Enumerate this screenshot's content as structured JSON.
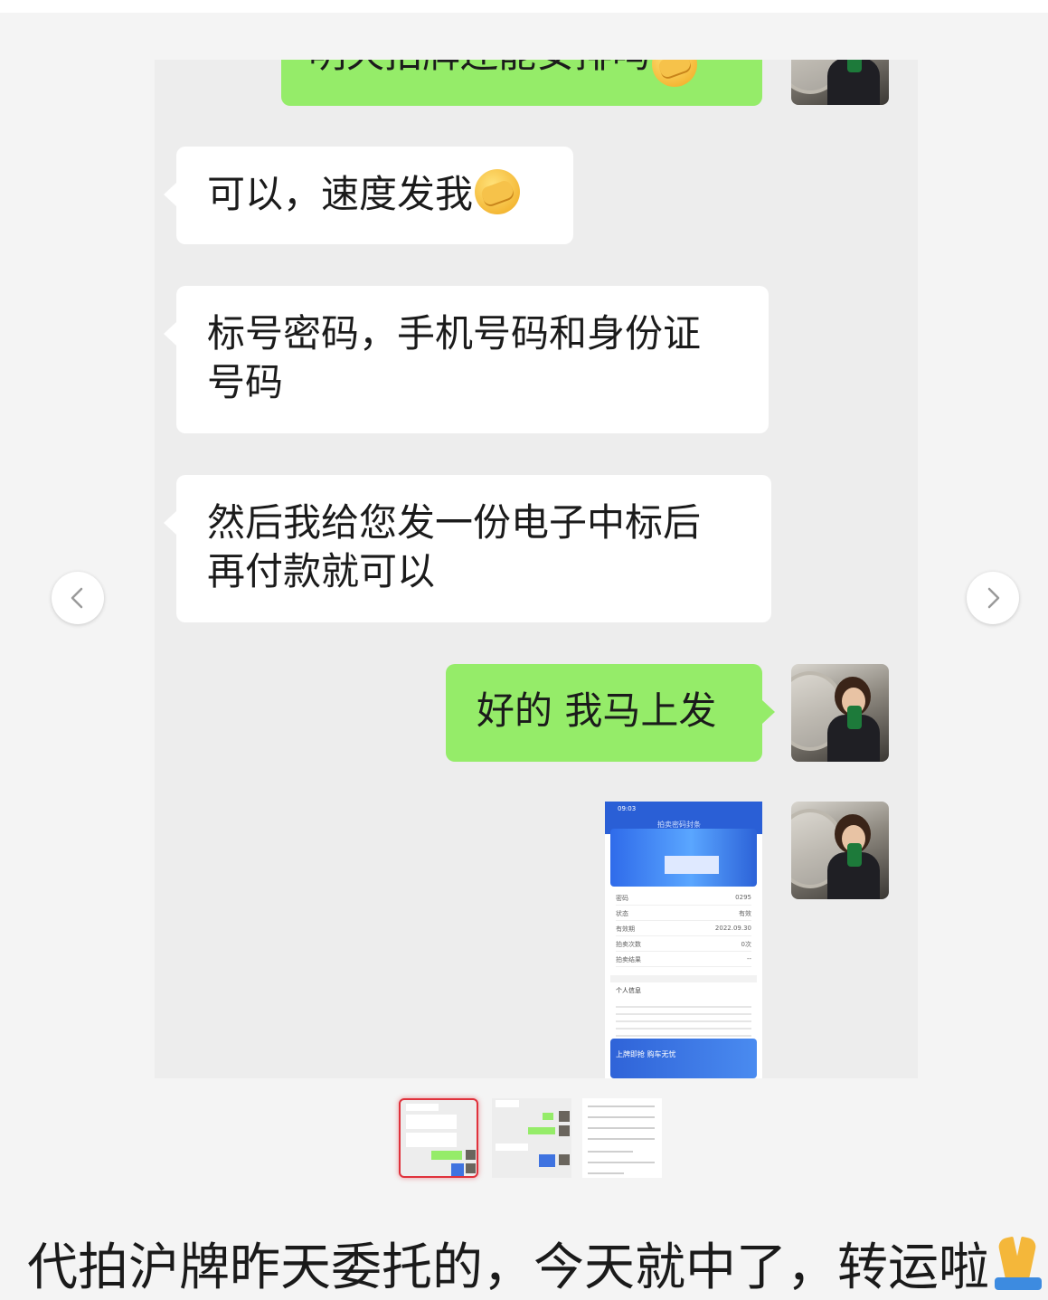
{
  "chat": {
    "partial_message": "明天拍牌还能安排吗",
    "messages": [
      {
        "side": "left",
        "text": "可以，速度发我",
        "emoji": "face-palm-emoji"
      },
      {
        "side": "left",
        "line1": "标号密码，手机号码和身份证",
        "line2": "号码"
      },
      {
        "side": "left",
        "line1": "然后我给您发一份电子中标后",
        "line2": "再付款就可以"
      },
      {
        "side": "right",
        "text": "好的 我马上发"
      }
    ],
    "screenshot": {
      "time": "09:03",
      "title": "拍卖密码封条",
      "rows": [
        {
          "k": "密码",
          "v": "0295"
        },
        {
          "k": "状态",
          "v": "有效"
        },
        {
          "k": "有效期",
          "v": "2022.09.30"
        },
        {
          "k": "拍卖次数",
          "v": "0次"
        },
        {
          "k": "拍卖结果",
          "v": "--"
        }
      ],
      "section": "个人信息",
      "ad": "上牌即抢 购车无忧"
    }
  },
  "navigation": {
    "prev": "previous-image",
    "next": "next-image"
  },
  "thumbnails": {
    "count": 3,
    "active_index": 0
  },
  "caption": "代拍沪牌昨天委托的，今天就中了，转运啦",
  "colors": {
    "sent_bubble": "#95ec69",
    "received_bubble": "#ffffff",
    "chat_bg": "#ededed",
    "active_thumb": "#e0323c"
  }
}
